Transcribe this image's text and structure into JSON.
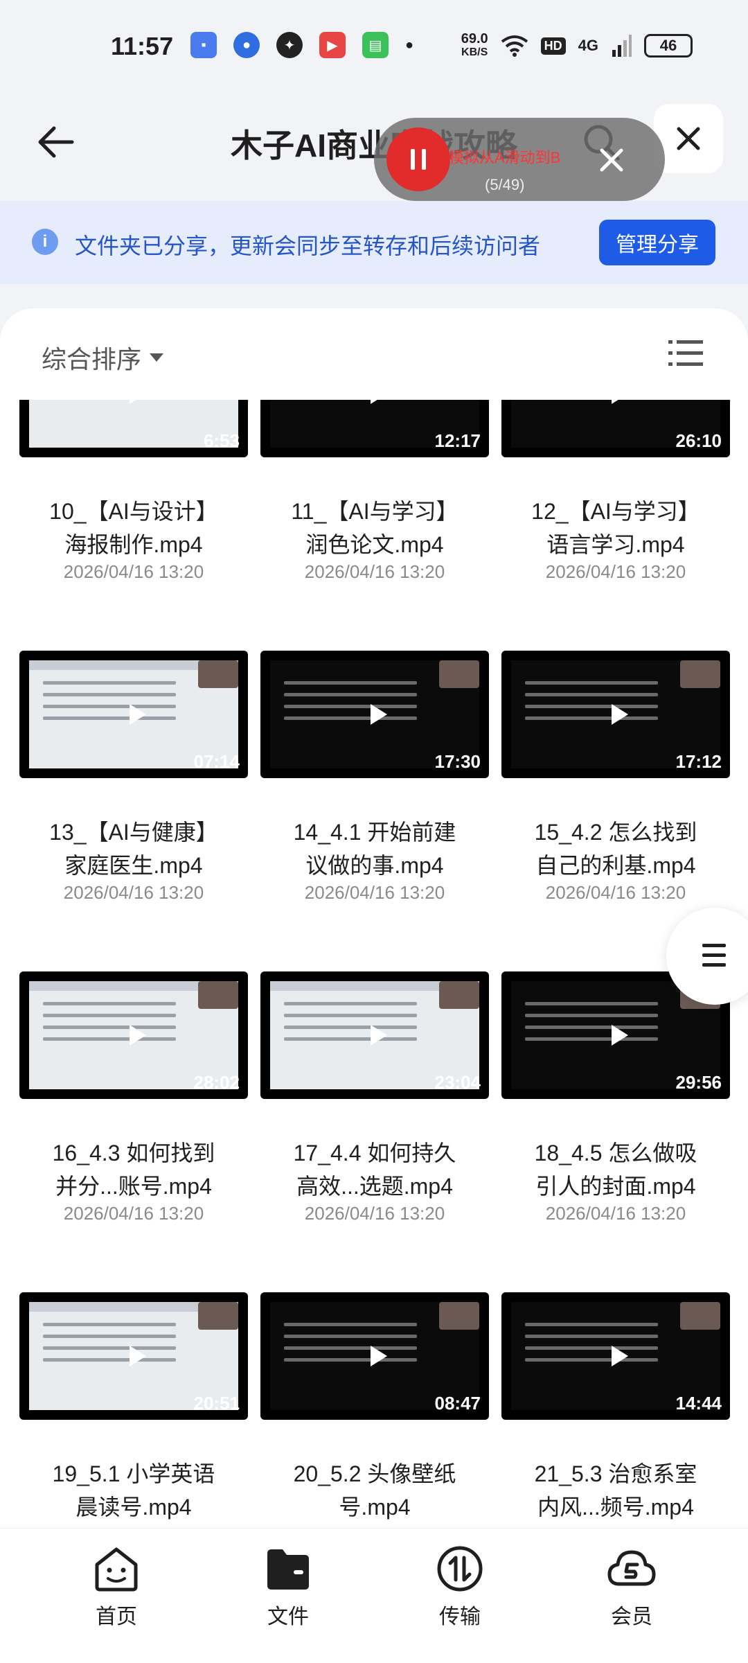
{
  "status_bar": {
    "time": "11:57",
    "net_speed": "69.0",
    "net_unit": "KB/S",
    "hd": "HD",
    "network": "4G",
    "battery": "46"
  },
  "header": {
    "title": "木子AI商业实战攻略"
  },
  "macro_overlay": {
    "action_text": "模拟从A滑动到B",
    "progress": "(5/49)"
  },
  "share_banner": {
    "text": "文件夹已分享，更新会同步至转存和后续访问者",
    "button": "管理分享"
  },
  "toolbar": {
    "sort_label": "综合排序"
  },
  "files": [
    {
      "name_line1": "10_【AI与设计】",
      "name_line2": "海报制作.mp4",
      "date": "2026/04/16 13:20",
      "duration": "6:53",
      "style": "light"
    },
    {
      "name_line1": "11_【AI与学习】",
      "name_line2": "润色论文.mp4",
      "date": "2026/04/16 13:20",
      "duration": "12:17",
      "style": "dark"
    },
    {
      "name_line1": "12_【AI与学习】",
      "name_line2": "语言学习.mp4",
      "date": "2026/04/16 13:20",
      "duration": "26:10",
      "style": "dark"
    },
    {
      "name_line1": "13_【AI与健康】",
      "name_line2": "家庭医生.mp4",
      "date": "2026/04/16 13:20",
      "duration": "07:14",
      "style": "light"
    },
    {
      "name_line1": "14_4.1 开始前建",
      "name_line2": "议做的事.mp4",
      "date": "2026/04/16 13:20",
      "duration": "17:30",
      "style": "dark"
    },
    {
      "name_line1": "15_4.2 怎么找到",
      "name_line2": "自己的利基.mp4",
      "date": "2026/04/16 13:20",
      "duration": "17:12",
      "style": "dark"
    },
    {
      "name_line1": "16_4.3 如何找到",
      "name_line2": "并分...账号.mp4",
      "date": "2026/04/16 13:20",
      "duration": "28:02",
      "style": "light"
    },
    {
      "name_line1": "17_4.4 如何持久",
      "name_line2": "高效...选题.mp4",
      "date": "2026/04/16 13:20",
      "duration": "23:04",
      "style": "light"
    },
    {
      "name_line1": "18_4.5 怎么做吸",
      "name_line2": "引人的封面.mp4",
      "date": "2026/04/16 13:20",
      "duration": "29:56",
      "style": "dark"
    },
    {
      "name_line1": "19_5.1 小学英语",
      "name_line2": "晨读号.mp4",
      "date": "",
      "duration": "20:51",
      "style": "light"
    },
    {
      "name_line1": "20_5.2 头像壁纸",
      "name_line2": "号.mp4",
      "date": "",
      "duration": "08:47",
      "style": "dark"
    },
    {
      "name_line1": "21_5.3 治愈系室",
      "name_line2": "内风...频号.mp4",
      "date": "",
      "duration": "14:44",
      "style": "dark"
    }
  ],
  "bottom_nav": [
    {
      "label": "首页",
      "icon": "home-face-icon"
    },
    {
      "label": "文件",
      "icon": "folder-icon"
    },
    {
      "label": "传输",
      "icon": "transfer-icon"
    },
    {
      "label": "会员",
      "icon": "vip-cloud-icon"
    }
  ],
  "colors": {
    "accent": "#1e5ce8",
    "banner_bg": "#e6ecfb",
    "banner_text": "#2456c8",
    "macro_red": "#e22b2b"
  }
}
